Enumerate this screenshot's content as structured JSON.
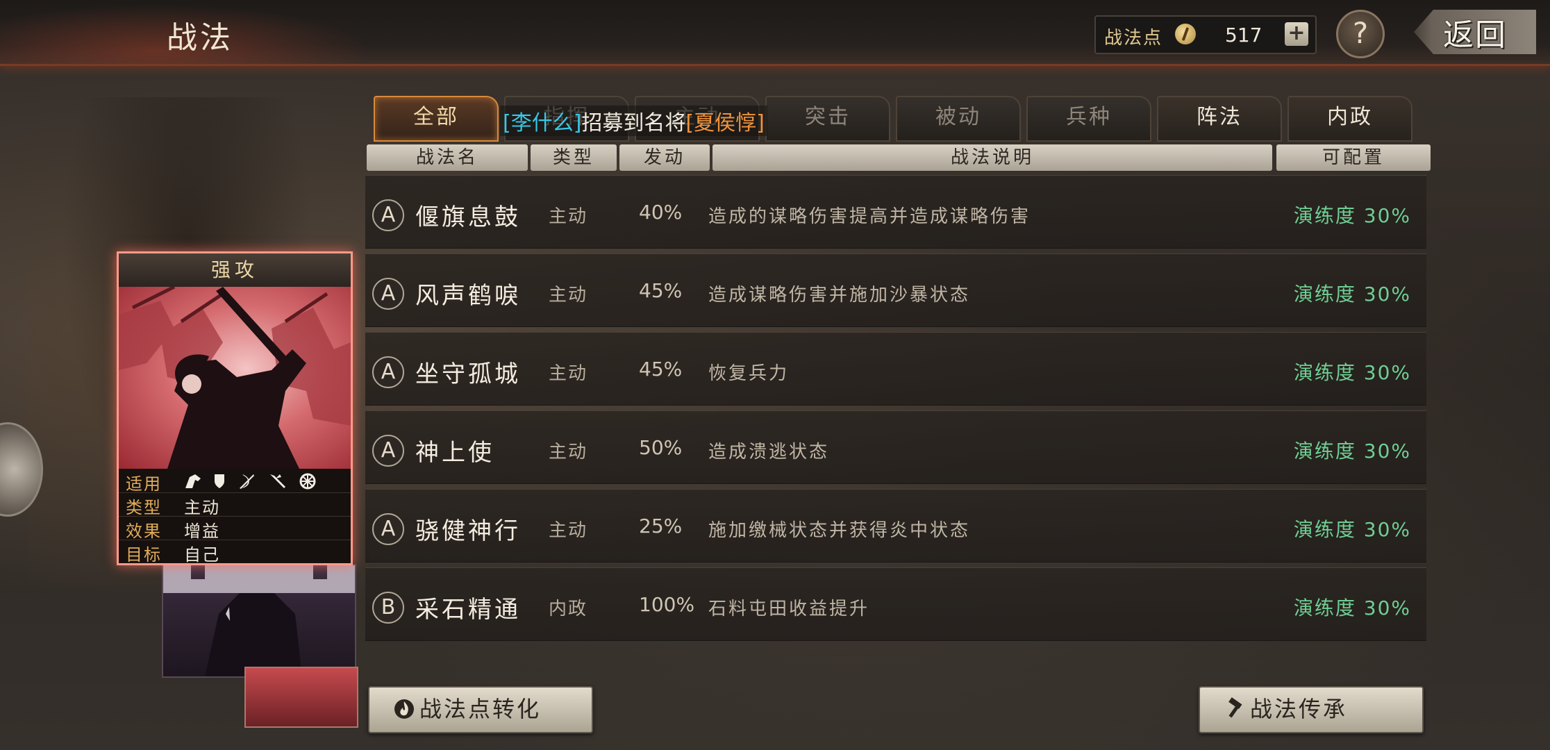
{
  "header": {
    "title": "战法",
    "points_label": "战法点",
    "points_value": "517",
    "plus_label": "+",
    "help_label": "?",
    "back_label": "返回"
  },
  "tabs": [
    {
      "label": "全部",
      "active": true
    },
    {
      "label": "指挥"
    },
    {
      "label": "主动"
    },
    {
      "label": "突击"
    },
    {
      "label": "被动"
    },
    {
      "label": "兵种"
    },
    {
      "label": "阵法"
    },
    {
      "label": "内政"
    }
  ],
  "recruit_banner": {
    "player": "[李什么]",
    "text": "招募到名将",
    "general": "[夏侯惇]"
  },
  "columns": {
    "name": "战法名",
    "type": "类型",
    "rate": "发动",
    "desc": "战法说明",
    "config": "可配置"
  },
  "skills": [
    {
      "grade": "A",
      "name": "偃旗息鼓",
      "type": "主动",
      "rate": "40%",
      "desc": "造成的谋略伤害提高并造成谋略伤害",
      "config": "演练度 30%"
    },
    {
      "grade": "A",
      "name": "风声鹤唳",
      "type": "主动",
      "rate": "45%",
      "desc": "造成谋略伤害并施加沙暴状态",
      "config": "演练度 30%"
    },
    {
      "grade": "A",
      "name": "坐守孤城",
      "type": "主动",
      "rate": "45%",
      "desc": "恢复兵力",
      "config": "演练度 30%"
    },
    {
      "grade": "A",
      "name": "神上使",
      "type": "主动",
      "rate": "50%",
      "desc": "造成溃逃状态",
      "config": "演练度 30%"
    },
    {
      "grade": "A",
      "name": "骁健神行",
      "type": "主动",
      "rate": "25%",
      "desc": "施加缴械状态并获得炎中状态",
      "config": "演练度 30%"
    },
    {
      "grade": "B",
      "name": "采石精通",
      "type": "内政",
      "rate": "100%",
      "desc": "石料屯田收益提升",
      "config": "演练度 30%"
    }
  ],
  "buttons": {
    "convert": "战法点转化",
    "inherit": "战法传承"
  },
  "card": {
    "title": "强攻",
    "rows": [
      {
        "key": "适用",
        "value": ""
      },
      {
        "key": "类型",
        "value": "主动"
      },
      {
        "key": "效果",
        "value": "增益"
      },
      {
        "key": "目标",
        "value": "自己"
      }
    ],
    "unit_icons": [
      "cavalry-icon",
      "shield-icon",
      "bow-icon",
      "spear-icon",
      "wheel-icon"
    ]
  },
  "colors": {
    "config_green": "#6fcf94",
    "tab_active_border": "#d98a3c",
    "banner_cyan": "#38c7e8",
    "banner_orange": "#f0933c",
    "card_glow": "#ff9a8a"
  }
}
